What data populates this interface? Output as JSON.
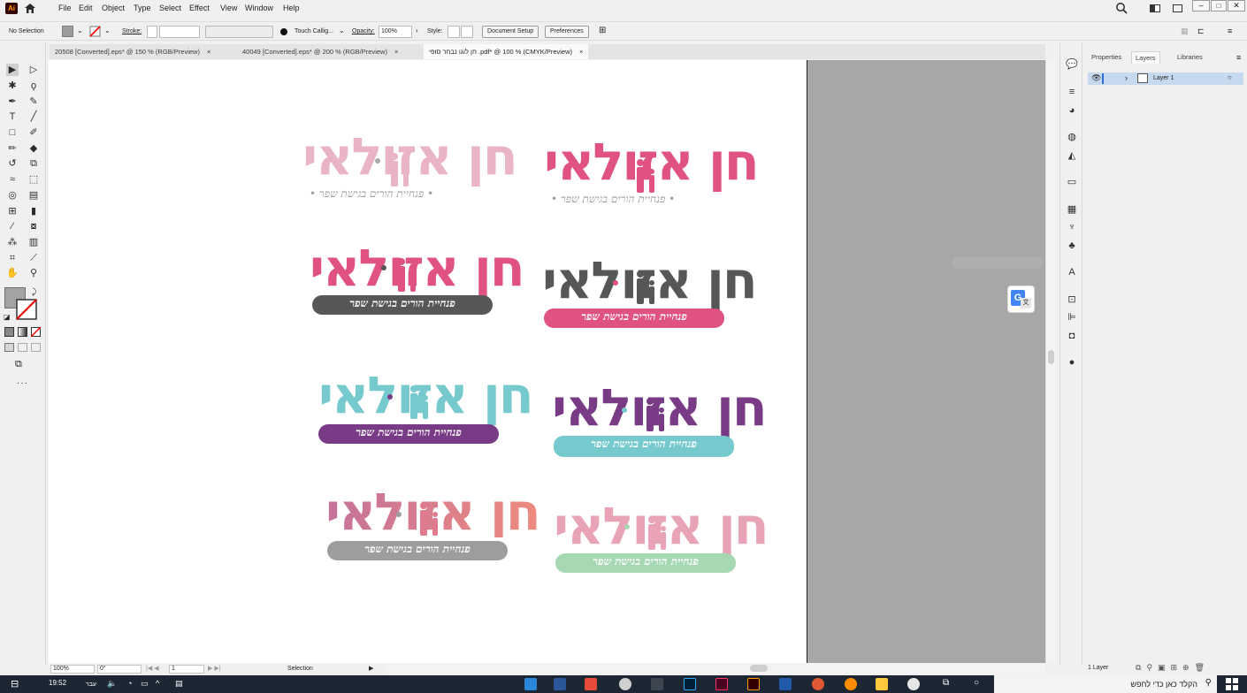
{
  "menubar": {
    "items": [
      "File",
      "Edit",
      "Object",
      "Type",
      "Select",
      "Effect",
      "View",
      "Window",
      "Help"
    ],
    "app_icon": "ai-logo",
    "app_badge": "Ai"
  },
  "controlbar": {
    "selection": "No Selection",
    "stroke_label": "Stroke:",
    "brush": "Touch Callig...",
    "opacity_label": "Opacity:",
    "opacity_value": "100%",
    "style_label": "Style:",
    "document_setup": "Document Setup",
    "preferences": "Preferences"
  },
  "tabs": [
    {
      "label": "20508 [Converted].eps* @ 150 % (RGB/Preview)"
    },
    {
      "label": "40049 [Converted].eps* @ 200 % (RGB/Preview)"
    },
    {
      "label": "חן לוגו נבחר סופי .pdf* @ 100 % (CMYK/Preview)"
    }
  ],
  "tab_close": "×",
  "panel": {
    "tabs": [
      "Properties",
      "Layers",
      "Libraries"
    ],
    "active_tab": "Layers",
    "layer_name": "Layer 1",
    "footer_count": "1 Layer"
  },
  "status": {
    "zoom": "100%",
    "rotation": "0°",
    "artboard": "1",
    "mode": "Selection"
  },
  "taskbar": {
    "time": "19:52",
    "lang": "עבר",
    "search_placeholder": "הקלד כאן כדי לחפש"
  },
  "logos": {
    "title": "חן אזולאי",
    "tagline": "פנחיית הורים בגישת שפר",
    "tagline_dotted": "• פנחיית הורים בגישת שפר •",
    "colors": {
      "pink_light": "#e9b4c4",
      "pink": "#e05283",
      "grey_dark": "#555759",
      "purple": "#7a3b86",
      "teal": "#76c9cd",
      "coral": "#ee8a7e",
      "grey_mid": "#9d9d9d",
      "mint": "#a6d8b4",
      "rose_soft": "#e8a3b7"
    }
  }
}
